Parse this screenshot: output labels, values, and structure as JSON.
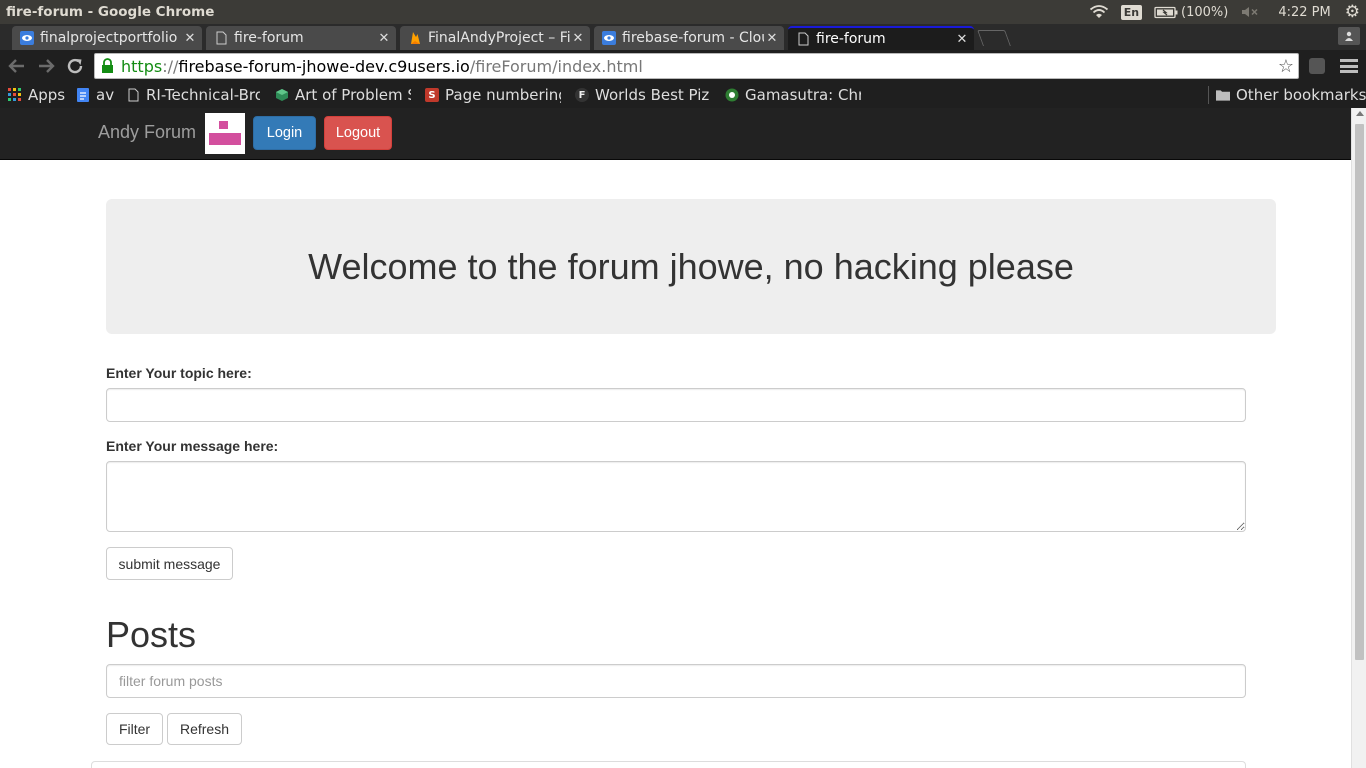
{
  "os": {
    "window_title": "fire-forum - Google Chrome",
    "lang": "En",
    "battery": "(100%)",
    "time": "4:22 PM"
  },
  "tabs": [
    {
      "label": "finalprojectportfolio",
      "icon": "eye-icon"
    },
    {
      "label": "fire-forum",
      "icon": "page-icon"
    },
    {
      "label": "FinalAndyProject – Fi",
      "icon": "firebase-icon"
    },
    {
      "label": "firebase-forum - Clou",
      "icon": "eye-icon"
    },
    {
      "label": "fire-forum",
      "icon": "page-icon",
      "active": true
    }
  ],
  "address": {
    "scheme": "https",
    "sep": "://",
    "host": "firebase-forum-jhowe-dev.c9users.io",
    "path": "/fireForum/index.html"
  },
  "bookmarks": [
    {
      "label": "Apps",
      "icon": "apps-grid-icon"
    },
    {
      "label": "av",
      "icon": "docs-icon"
    },
    {
      "label": "RI-Technical-Broch",
      "icon": "page-icon"
    },
    {
      "label": "Art of Problem So",
      "icon": "aops-icon"
    },
    {
      "label": "Page numbering",
      "icon": "s-icon"
    },
    {
      "label": "Worlds Best Pizza",
      "icon": "f-icon"
    },
    {
      "label": "Gamasutra: Chris",
      "icon": "gamasutra-icon"
    },
    {
      "label": "Other bookmarks",
      "icon": "folder-icon"
    }
  ],
  "navbar": {
    "brand": "Andy Forum",
    "login": "Login",
    "logout": "Logout"
  },
  "jumbotron": {
    "heading": "Welcome to the forum jhowe, no hacking please"
  },
  "form": {
    "topic_label": "Enter Your topic here:",
    "topic_value": "",
    "message_label": "Enter Your message here:",
    "message_value": "",
    "submit": "submit message"
  },
  "posts": {
    "heading": "Posts",
    "filter_placeholder": "filter forum posts",
    "filter_button": "Filter",
    "refresh_button": "Refresh"
  },
  "colors": {
    "navbar_bg": "#222222",
    "login_btn": "#337ab7",
    "logout_btn": "#d9534f",
    "jumbotron_bg": "#eeeeee",
    "logo_pink": "#d34f9e",
    "url_https": "#138c13"
  }
}
